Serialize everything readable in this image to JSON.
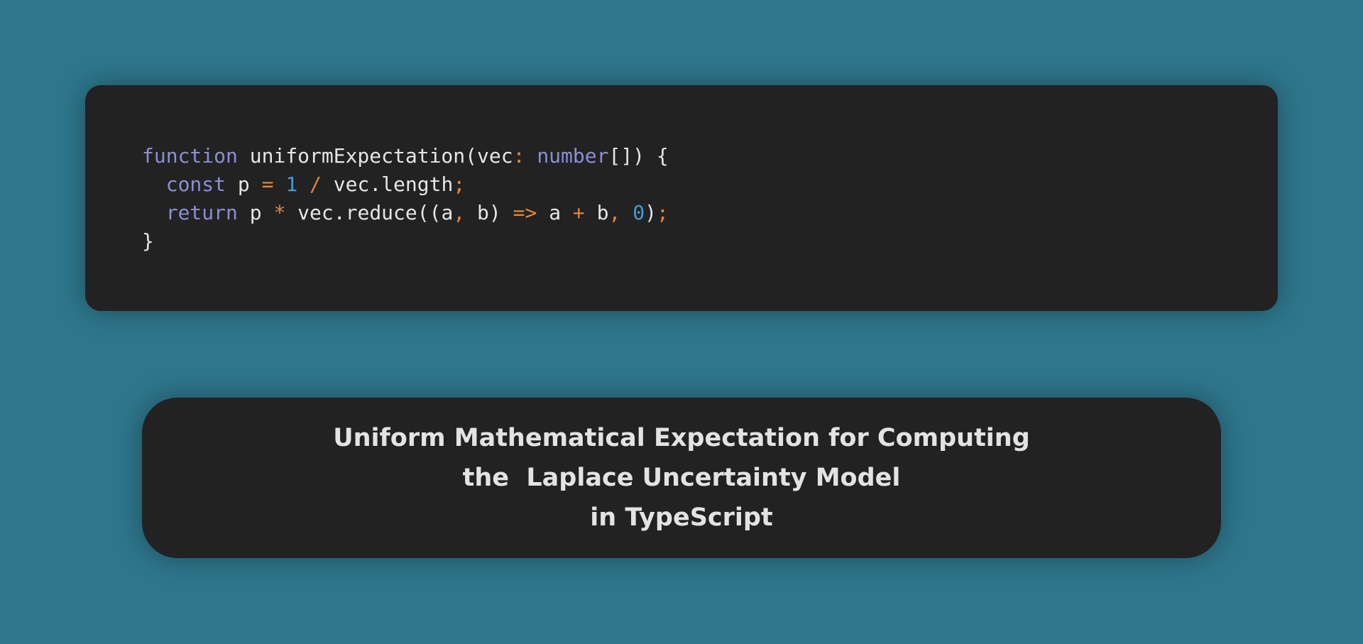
{
  "colors": {
    "background": "#2e768c",
    "card": "#222222",
    "keyword": "#8b8fd4",
    "operator": "#e0873a",
    "number": "#3e9ed6",
    "text": "#e6e6e6"
  },
  "code": {
    "language": "TypeScript",
    "lines": [
      [
        {
          "t": "function",
          "k": "kw"
        },
        {
          "t": " uniformExpectation(vec",
          "k": "plain"
        },
        {
          "t": ":",
          "k": "op"
        },
        {
          "t": " ",
          "k": "plain"
        },
        {
          "t": "number",
          "k": "type"
        },
        {
          "t": "[]) {",
          "k": "plain"
        }
      ],
      [
        {
          "t": "  ",
          "k": "plain"
        },
        {
          "t": "const",
          "k": "kw"
        },
        {
          "t": " p ",
          "k": "plain"
        },
        {
          "t": "=",
          "k": "op"
        },
        {
          "t": " ",
          "k": "plain"
        },
        {
          "t": "1",
          "k": "num"
        },
        {
          "t": " ",
          "k": "plain"
        },
        {
          "t": "/",
          "k": "op"
        },
        {
          "t": " vec.length",
          "k": "plain"
        },
        {
          "t": ";",
          "k": "op"
        }
      ],
      [
        {
          "t": "  ",
          "k": "plain"
        },
        {
          "t": "return",
          "k": "kw"
        },
        {
          "t": " p ",
          "k": "plain"
        },
        {
          "t": "*",
          "k": "op"
        },
        {
          "t": " vec.reduce((a",
          "k": "plain"
        },
        {
          "t": ",",
          "k": "op"
        },
        {
          "t": " b) ",
          "k": "plain"
        },
        {
          "t": "=>",
          "k": "op"
        },
        {
          "t": " a ",
          "k": "plain"
        },
        {
          "t": "+",
          "k": "op"
        },
        {
          "t": " b",
          "k": "plain"
        },
        {
          "t": ",",
          "k": "op"
        },
        {
          "t": " ",
          "k": "plain"
        },
        {
          "t": "0",
          "k": "num"
        },
        {
          "t": ")",
          "k": "plain"
        },
        {
          "t": ";",
          "k": "op"
        }
      ],
      [
        {
          "t": "}",
          "k": "plain"
        }
      ]
    ]
  },
  "title": {
    "line1": "Uniform Mathematical Expectation for Computing",
    "line2": "the  Laplace Uncertainty Model",
    "line3": "in TypeScript"
  }
}
